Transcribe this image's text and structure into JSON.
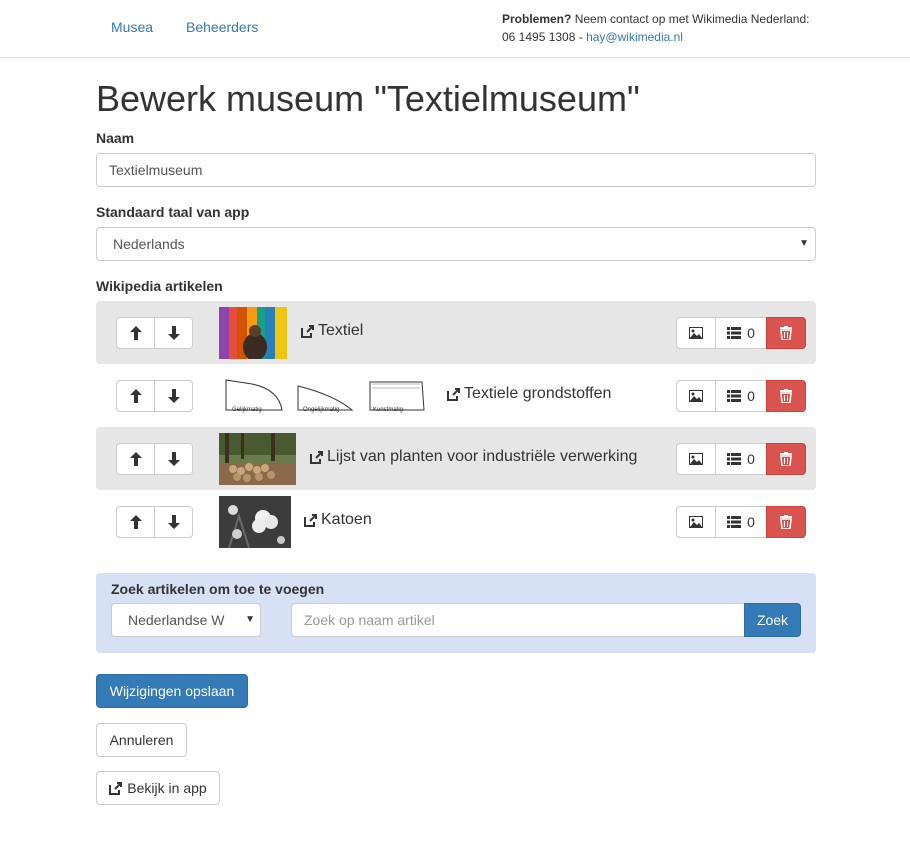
{
  "nav": {
    "items": [
      {
        "label": "Musea"
      },
      {
        "label": "Beheerders"
      }
    ],
    "contact": {
      "bold": "Problemen?",
      "text": " Neem contact op met Wikimedia Nederland:",
      "phone": "06 1495 1308 - ",
      "email": "hay@wikimedia.nl"
    }
  },
  "page": {
    "title": "Bewerk museum \"Textielmuseum\""
  },
  "form": {
    "name_label": "Naam",
    "name_value": "Textielmuseum",
    "language_label": "Standaard taal van app",
    "language_value": "Nederlands",
    "articles_label": "Wikipedia artikelen"
  },
  "articles": [
    {
      "title": "Textiel",
      "count": "0",
      "shaded": true
    },
    {
      "title": "Textiele grondstoffen",
      "count": "0",
      "shaded": false,
      "diagram_labels": [
        "Gelijkmatig",
        "Ongelijkmatig",
        "Kunstmatig"
      ]
    },
    {
      "title": "Lijst van planten voor industriële verwerking",
      "count": "0",
      "shaded": true
    },
    {
      "title": "Katoen",
      "count": "0",
      "shaded": false
    }
  ],
  "search": {
    "title": "Zoek artikelen om toe te voegen",
    "language_value": "Nederlandse W",
    "placeholder": "Zoek op naam artikel",
    "button_label": "Zoek"
  },
  "buttons": {
    "save": "Wijzigingen opslaan",
    "cancel": "Annuleren",
    "view_in_app": "Bekijk in app"
  },
  "colors": {
    "primary": "#337ab7",
    "danger": "#d9534f",
    "panel": "#d6e1f5",
    "row_shade": "#e6e6e6"
  }
}
